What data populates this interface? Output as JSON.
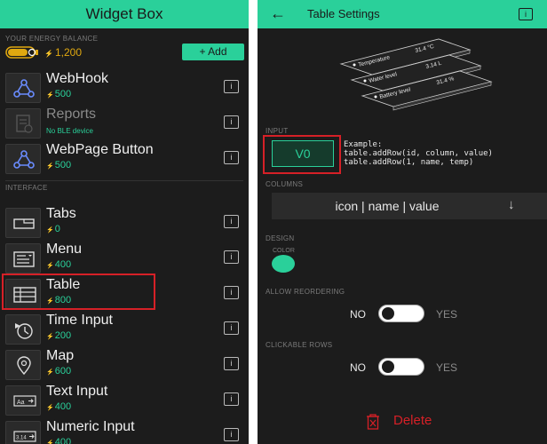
{
  "left": {
    "title": "Widget Box",
    "energy_label": "YOUR ENERGY BALANCE",
    "energy_currency": "⚡",
    "energy_value": "1,200",
    "add_label": "+ Add",
    "interface_label": "INTERFACE",
    "currency": "⚡",
    "info_label": "i",
    "widgets_top": [
      {
        "name": "WebHook",
        "price": "500",
        "icon": "webhook-icon"
      },
      {
        "name": "Reports",
        "price": "No BLE device",
        "icon": "reports-icon",
        "disabled": true
      },
      {
        "name": "WebPage Button",
        "price": "500",
        "icon": "webpage-button-icon"
      }
    ],
    "widgets_interface": [
      {
        "name": "Tabs",
        "price": "0",
        "icon": "tabs-icon"
      },
      {
        "name": "Menu",
        "price": "400",
        "icon": "menu-icon"
      },
      {
        "name": "Table",
        "price": "800",
        "icon": "table-icon"
      },
      {
        "name": "Time Input",
        "price": "200",
        "icon": "time-input-icon"
      },
      {
        "name": "Map",
        "price": "600",
        "icon": "map-icon"
      },
      {
        "name": "Text Input",
        "price": "400",
        "icon": "text-input-icon"
      },
      {
        "name": "Numeric Input",
        "price": "400",
        "icon": "numeric-input-icon"
      }
    ],
    "icon_text": {
      "text_input": "Aa",
      "numeric_input": "3.14"
    }
  },
  "right": {
    "title": "Table Settings",
    "back": "←",
    "info_label": "i",
    "preview_rows": [
      {
        "name": "Temperature",
        "value": "31.4 °C"
      },
      {
        "name": "Water level",
        "value": "3.14 L"
      },
      {
        "name": "Battery level",
        "value": "31.4 %"
      }
    ],
    "input_label": "INPUT",
    "pin": "V0",
    "example": "Example:\ntable.addRow(id, column, value)\ntable.addRow(1, name, temp)",
    "columns_label": "COLUMNS",
    "columns_value": "icon | name | value",
    "columns_arrow": "↓",
    "design_label": "DESIGN",
    "color_label": "COLOR",
    "allow_reordering_label": "ALLOW REORDERING",
    "clickable_rows_label": "CLICKABLE ROWS",
    "no_label": "NO",
    "yes_label": "YES",
    "delete_label": "Delete"
  },
  "colors": {
    "accent": "#2ad09a",
    "highlight": "#d62027",
    "background": "#1c1c1c"
  }
}
